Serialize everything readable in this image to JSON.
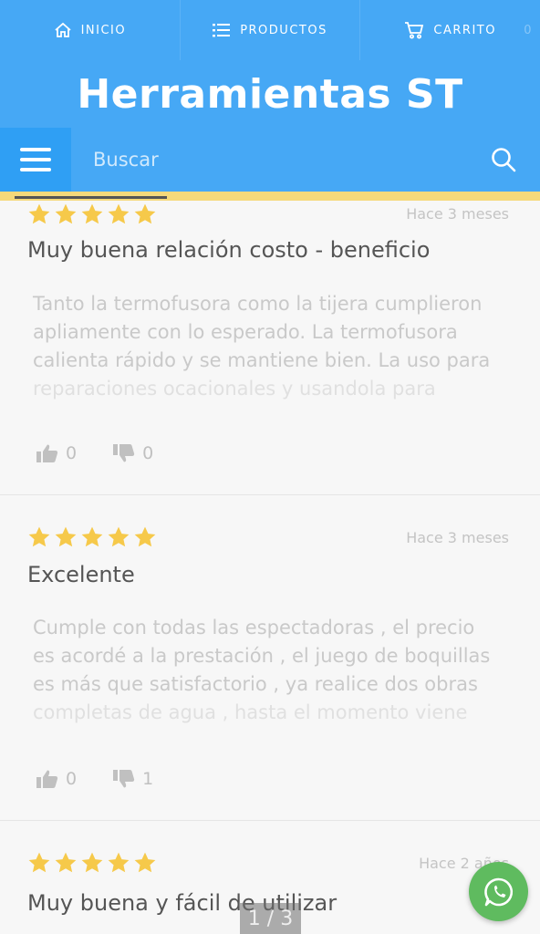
{
  "nav": {
    "items": [
      {
        "label": "INICIO",
        "icon": "home-icon"
      },
      {
        "label": "PRODUCTOS",
        "icon": "list-icon"
      },
      {
        "label": "CARRITO",
        "icon": "cart-icon"
      }
    ],
    "cart_count": "0"
  },
  "brand": {
    "title": "Herramientas ST"
  },
  "search": {
    "placeholder": "Buscar"
  },
  "colors": {
    "primary": "#46a8f5",
    "accent": "#f5d97a",
    "star": "#f6c94a",
    "whatsapp": "#5fbb5f"
  },
  "reviews": [
    {
      "rating": 5,
      "date": "Hace 3 meses",
      "title": "Muy buena relación costo - beneficio",
      "body": [
        "Tanto la termofusora como la tijera cumplieron",
        "apliamente con lo esperado. La termofusora",
        "calienta rápido y se mantiene bien. La uso para",
        "reparaciones ocacionales y usandola para"
      ],
      "likes": "0",
      "dislikes": "0"
    },
    {
      "rating": 5,
      "date": "Hace 3 meses",
      "title": "Excelente",
      "body": [
        "Cumple con todas las espectadoras , el precio",
        "es acordé a la prestación , el juego de boquillas",
        "es más que satisfactorio , ya realice dos obras",
        "completas de agua , hasta el momento viene"
      ],
      "likes": "0",
      "dislikes": "1"
    },
    {
      "rating": 5,
      "date": "Hace 2 años",
      "title": "Muy buena y fácil de utilizar",
      "body": [],
      "likes": "",
      "dislikes": ""
    }
  ],
  "pager": {
    "text": "1 / 3"
  }
}
